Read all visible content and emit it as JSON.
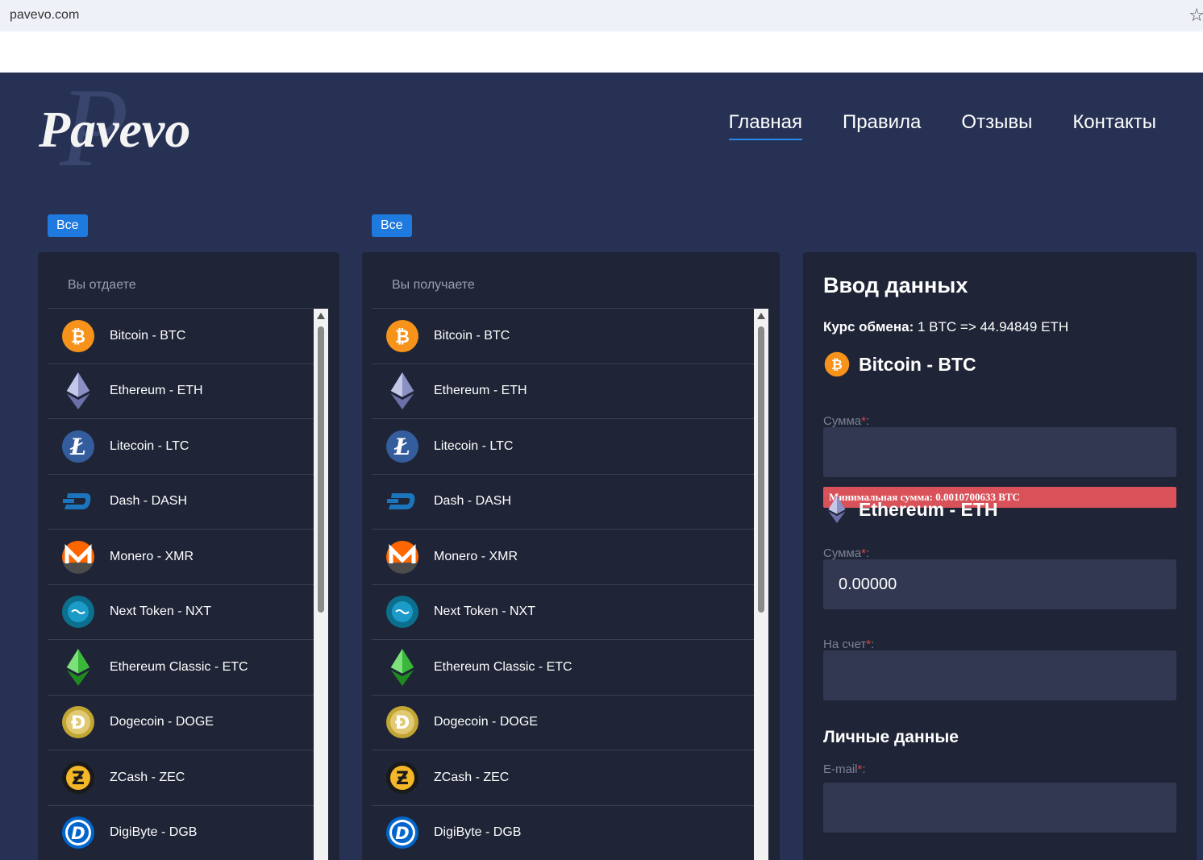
{
  "browser": {
    "url": "pavevo.com"
  },
  "logo": {
    "text": "Pavevo"
  },
  "nav": [
    {
      "label": "Главная",
      "active": true
    },
    {
      "label": "Правила",
      "active": false
    },
    {
      "label": "Отзывы",
      "active": false
    },
    {
      "label": "Контакты",
      "active": false
    }
  ],
  "filters": {
    "give_label": "Все",
    "get_label": "Все"
  },
  "give_panel": {
    "title": "Вы отдаете"
  },
  "get_panel": {
    "title": "Вы получаете"
  },
  "coins": [
    {
      "label": "Bitcoin - BTC",
      "icon": "bitcoin-icon"
    },
    {
      "label": "Ethereum - ETH",
      "icon": "ethereum-icon"
    },
    {
      "label": "Litecoin - LTC",
      "icon": "litecoin-icon"
    },
    {
      "label": "Dash - DASH",
      "icon": "dash-icon"
    },
    {
      "label": "Monero - XMR",
      "icon": "monero-icon"
    },
    {
      "label": "Next Token - NXT",
      "icon": "nxt-icon"
    },
    {
      "label": "Ethereum Classic - ETC",
      "icon": "ethereum-classic-icon"
    },
    {
      "label": "Dogecoin - DOGE",
      "icon": "dogecoin-icon"
    },
    {
      "label": "ZCash - ZEC",
      "icon": "zcash-icon"
    },
    {
      "label": "DigiByte - DGB",
      "icon": "digibyte-icon"
    }
  ],
  "form": {
    "title": "Ввод данных",
    "rate_label": "Курс обмена:",
    "rate_value": "1 BTC => 44.94849 ETH",
    "give_coin": "Bitcoin - BTC",
    "get_coin": "Ethereum - ETH",
    "amount_label": "Сумма",
    "required_mark": "*",
    "colon": ":",
    "give_amount_value": "",
    "min_amount_error": "Минимальная сумма: 0.0010700633 BTC",
    "get_amount_value": "0.00000",
    "account_label": "На счет",
    "account_value": "",
    "personal_title": "Личные данные",
    "email_label": "E-mail",
    "email_value": ""
  },
  "colors": {
    "background": "#263153",
    "panel": "#1f2436",
    "accent": "#1f7ae0",
    "error": "#d9525a"
  }
}
